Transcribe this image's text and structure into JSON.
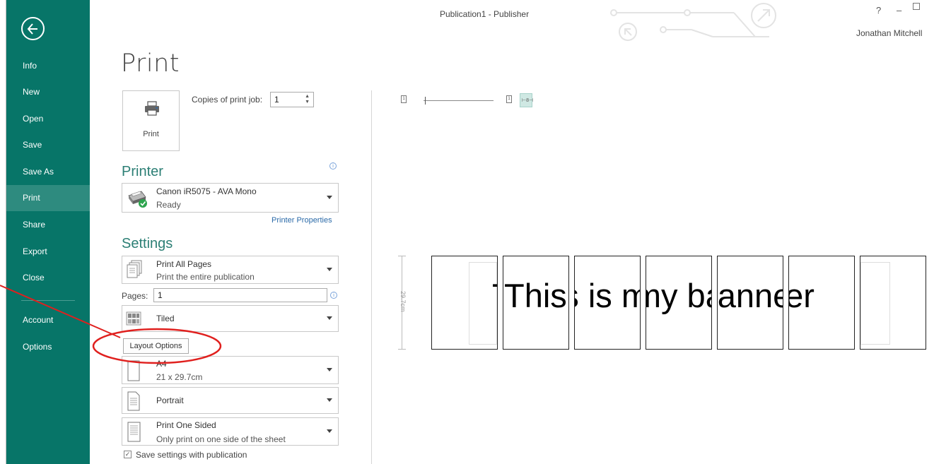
{
  "window": {
    "title": "Publication1 - Publisher",
    "help": "?",
    "minimize": "–",
    "user": "Jonathan Mitchell"
  },
  "sidebar": {
    "items": [
      {
        "label": "Info"
      },
      {
        "label": "New"
      },
      {
        "label": "Open"
      },
      {
        "label": "Save"
      },
      {
        "label": "Save As"
      },
      {
        "label": "Print"
      },
      {
        "label": "Share"
      },
      {
        "label": "Export"
      },
      {
        "label": "Close"
      },
      {
        "label": "Account"
      },
      {
        "label": "Options"
      }
    ],
    "active": "Print",
    "accent": "#077568"
  },
  "print": {
    "heading": "Print",
    "button_label": "Print",
    "copies_label": "Copies of print job:",
    "copies_value": "1"
  },
  "printer": {
    "section_title": "Printer",
    "name": "Canon iR5075 - AVA Mono",
    "status": "Ready",
    "properties_link": "Printer Properties"
  },
  "settings": {
    "section_title": "Settings",
    "pages_option": {
      "title": "Print All Pages",
      "subtitle": "Print the entire publication"
    },
    "pages_label": "Pages:",
    "pages_value": "1",
    "layout": {
      "title": "Tiled"
    },
    "layout_options_button": "Layout Options",
    "paper": {
      "title": "A4",
      "subtitle": "21 x 29.7cm"
    },
    "orientation": {
      "title": "Portrait"
    },
    "sides": {
      "title": "Print One Sided",
      "subtitle": "Only print on one side of the sheet"
    },
    "save_settings_label": "Save settings with publication",
    "save_settings_checked": true
  },
  "preview": {
    "page_icon_1": "1",
    "page_icon_2": "1",
    "ruler_label": "29.7cm",
    "banner_text": "This is my banner",
    "tile_count": 7
  },
  "annotation": {
    "color": "#e0201e",
    "target": "Layout Options"
  }
}
